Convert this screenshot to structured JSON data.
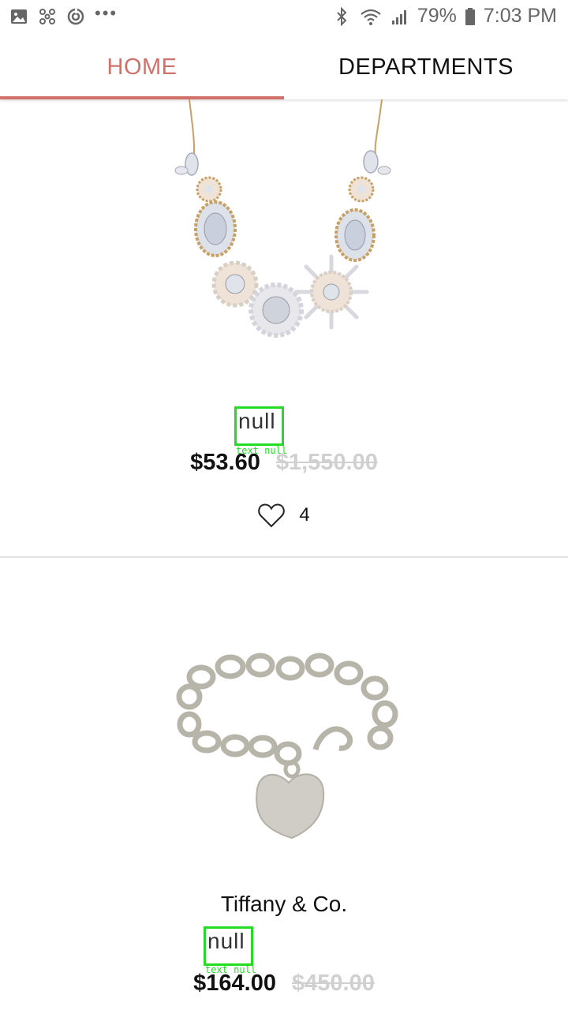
{
  "status_bar": {
    "battery": "79%",
    "time": "7:03 PM",
    "more": "•••",
    "left_icons": [
      "gallery-icon",
      "pinwheel-icon",
      "sync-icon"
    ],
    "right_icons": [
      "bluetooth-icon",
      "wifi-icon",
      "signal-icon",
      "battery-icon"
    ]
  },
  "tabs": [
    {
      "label": "HOME",
      "active": true
    },
    {
      "label": "DEPARTMENTS",
      "active": false
    }
  ],
  "accent_color": "#d2716b",
  "products": [
    {
      "image": "necklace-image",
      "brand": "",
      "subtitle": "null",
      "subtitle_tag": "text null",
      "price": "$53.60",
      "original_price": "$1,550.00",
      "likes": "4"
    },
    {
      "image": "bracelet-image",
      "brand": "Tiffany & Co.",
      "subtitle": "null",
      "subtitle_tag": "text null",
      "price": "$164.00",
      "original_price": "$450.00"
    }
  ]
}
